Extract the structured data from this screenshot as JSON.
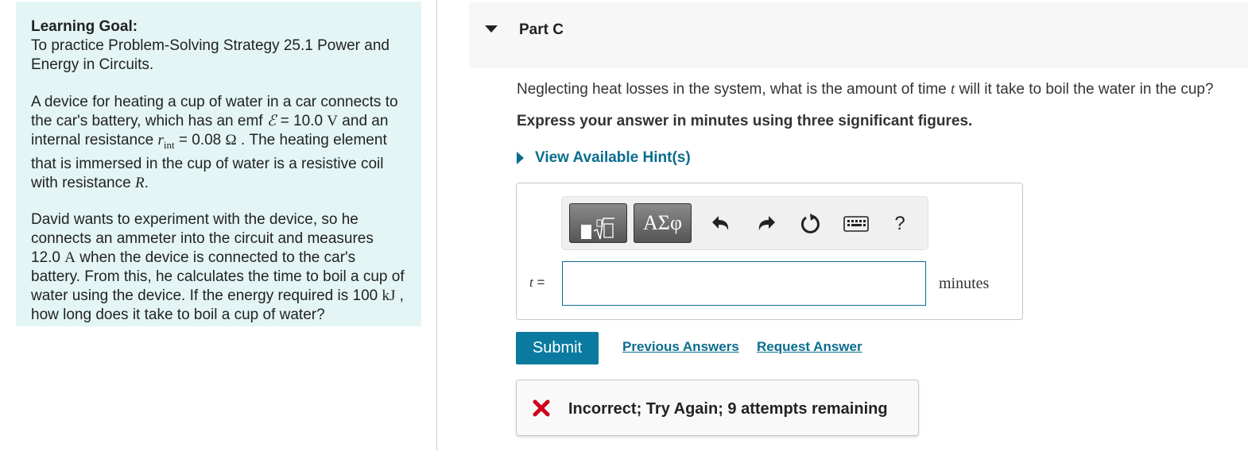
{
  "colors": {
    "accent": "#0a7aa0",
    "link": "#0a6d8e",
    "goal_bg": "#e4f5f5",
    "error": "#d0021b"
  },
  "goal": {
    "heading": "Learning Goal:",
    "text": "To practice Problem-Solving Strategy 25.1 Power and Energy in Circuits.",
    "p1": {
      "t1": "A device for heating a cup of water in a car connects to the car's battery, which has an emf ",
      "emf_symbol": "ℰ",
      "t2": " = 10.0 ",
      "emf_unit": "V",
      "t3": " and an internal resistance ",
      "r_symbol": "r",
      "r_sub": "int",
      "t4": " = 0.08 ",
      "r_unit": "Ω",
      "t5": " . The heating element that is immersed in the cup of water is a resistive coil with resistance ",
      "R_symbol": "R",
      "t6": "."
    },
    "p2": {
      "t1": "David wants to experiment with the device, so he connects an ammeter into the circuit and measures 12.0 ",
      "current_unit": "A",
      "t2": " when the device is connected to the car's battery. From this, he calculates the time to boil a cup of water using the device. If the energy required is 100 ",
      "energy_unit": "kJ",
      "t3": " , how long does it take to boil a cup of water?"
    }
  },
  "part": {
    "title": "Part C"
  },
  "question": {
    "t1": "Neglecting heat losses in the system, what is the amount of time ",
    "var": "t",
    "t2": " will it take to boil the water in the cup?"
  },
  "instruction": "Express your answer in minutes using three significant figures.",
  "hint_label": "View Available Hint(s)",
  "toolbar": {
    "greek_label": "ΑΣφ",
    "help_label": "?",
    "icons": [
      "templates-icon",
      "undo-icon",
      "redo-icon",
      "reset-icon",
      "keyboard-icon",
      "help-icon"
    ]
  },
  "answer": {
    "var": "t",
    "equals": " =",
    "value": "",
    "unit": "minutes"
  },
  "submit_label": "Submit",
  "previous_answers_label": "Previous Answers",
  "request_answer_label": "Request Answer",
  "feedback": "Incorrect; Try Again; 9 attempts remaining"
}
